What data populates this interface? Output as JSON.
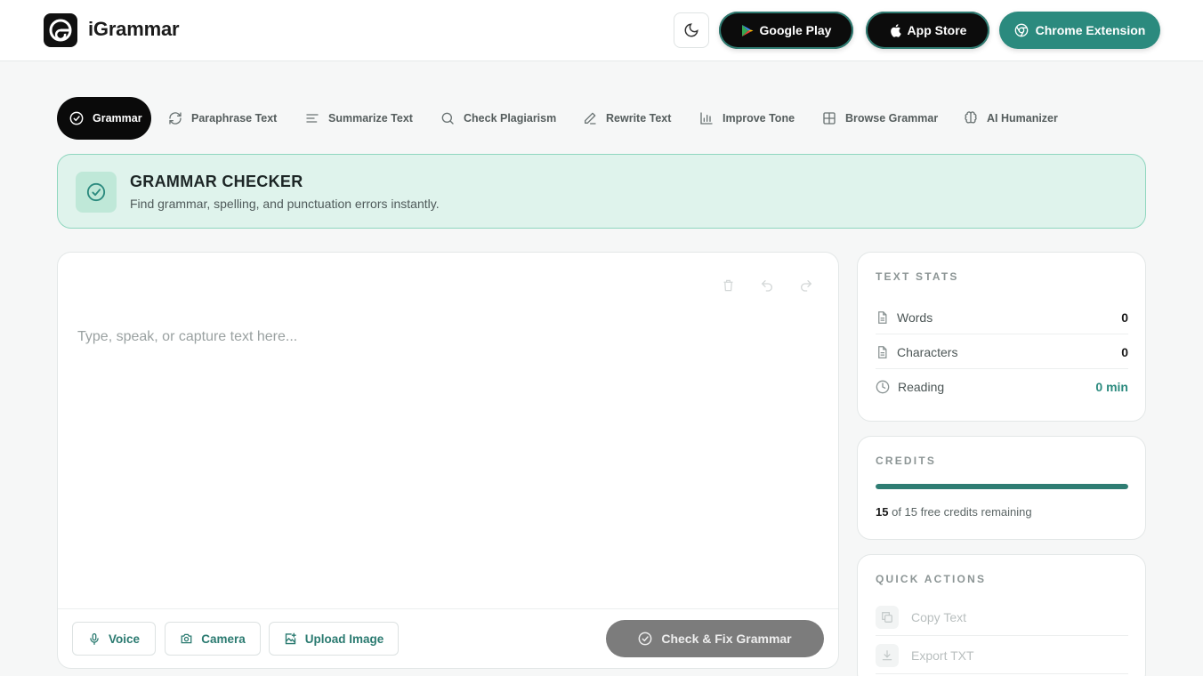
{
  "header": {
    "brand": "iGrammar",
    "google_play": "Google Play",
    "app_store": "App Store",
    "chrome_extension": "Chrome Extension"
  },
  "tabs": [
    {
      "label": "Grammar",
      "icon": "check-circle-icon",
      "active": true
    },
    {
      "label": "Paraphrase Text",
      "icon": "refresh-icon"
    },
    {
      "label": "Summarize Text",
      "icon": "align-left-icon"
    },
    {
      "label": "Check Plagiarism",
      "icon": "search-icon"
    },
    {
      "label": "Rewrite Text",
      "icon": "pencil-icon"
    },
    {
      "label": "Improve Tone",
      "icon": "bar-chart-icon"
    },
    {
      "label": "Browse Grammar",
      "icon": "grid-icon"
    },
    {
      "label": "AI Humanizer",
      "icon": "brain-icon"
    }
  ],
  "banner": {
    "title": "GRAMMAR CHECKER",
    "subtitle": "Find grammar, spelling, and punctuation errors instantly."
  },
  "editor": {
    "placeholder": "Type, speak, or capture text here...",
    "voice": "Voice",
    "camera": "Camera",
    "upload": "Upload Image",
    "check": "Check & Fix Grammar"
  },
  "stats": {
    "title": "TEXT STATS",
    "rows": [
      {
        "label": "Words",
        "value": "0"
      },
      {
        "label": "Characters",
        "value": "0"
      },
      {
        "label": "Reading",
        "value": "0 min"
      }
    ]
  },
  "credits": {
    "title": "CREDITS",
    "remaining": "15",
    "suffix": "of 15 free credits remaining",
    "fraction": 1.0
  },
  "quick_actions": {
    "title": "QUICK ACTIONS",
    "items": [
      "Copy Text",
      "Export TXT"
    ]
  },
  "colors": {
    "accent": "#2b8a7e",
    "banner_bg": "#dff3ec",
    "banner_border": "#8fd6bf"
  }
}
